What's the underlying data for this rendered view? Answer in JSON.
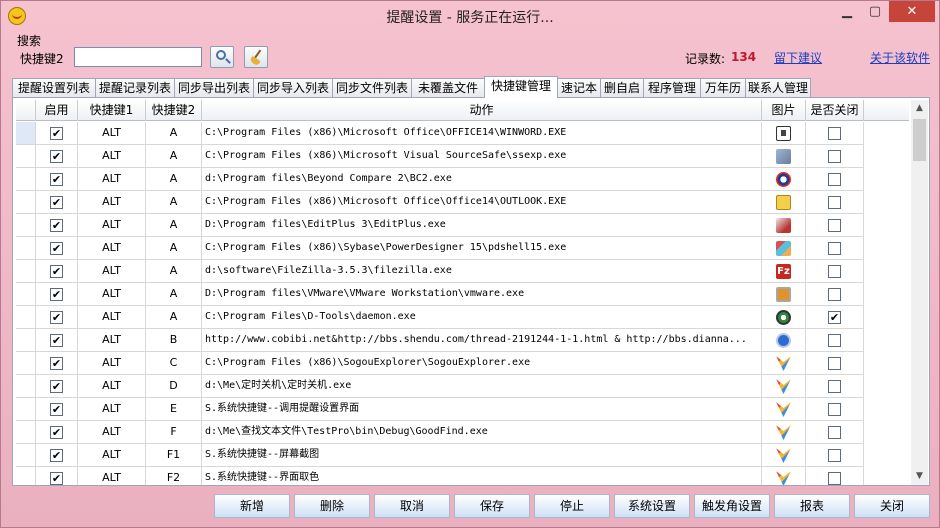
{
  "window": {
    "title": "提醒设置 - 服务正在运行..."
  },
  "search": {
    "group_label": "搜索",
    "hotkey_label": "快捷键2",
    "input_value": "",
    "record_label": "记录数:",
    "record_count": "134",
    "suggest_link": "留下建议",
    "about_link": "关于该软件"
  },
  "tabs": [
    {
      "label": "提醒设置列表"
    },
    {
      "label": "提醒记录列表"
    },
    {
      "label": "同步导出列表"
    },
    {
      "label": "同步导入列表"
    },
    {
      "label": "同步文件列表"
    },
    {
      "label": "未覆盖文件"
    },
    {
      "label": "快捷键管理",
      "active": true
    },
    {
      "label": "速记本"
    },
    {
      "label": "删自启"
    },
    {
      "label": "程序管理"
    },
    {
      "label": "万年历"
    },
    {
      "label": "联系人管理"
    }
  ],
  "table": {
    "columns": [
      "启用",
      "快捷键1",
      "快捷键2",
      "动作",
      "图片",
      "是否关闭"
    ],
    "rows": [
      {
        "enabled": true,
        "k1": "ALT",
        "k2": "A",
        "action": "C:\\Program Files (x86)\\Microsoft Office\\OFFICE14\\WINWORD.EXE",
        "icon": "word-icon",
        "close": false
      },
      {
        "enabled": true,
        "k1": "ALT",
        "k2": "A",
        "action": "C:\\Program Files (x86)\\Microsoft Visual SourceSafe\\ssexp.exe",
        "icon": "sourcesafe-icon",
        "close": false
      },
      {
        "enabled": true,
        "k1": "ALT",
        "k2": "A",
        "action": "d:\\Program files\\Beyond Compare 2\\BC2.exe",
        "icon": "beyond-compare-icon",
        "close": false
      },
      {
        "enabled": true,
        "k1": "ALT",
        "k2": "A",
        "action": "C:\\Program Files (x86)\\Microsoft Office\\Office14\\OUTLOOK.EXE",
        "icon": "outlook-icon",
        "close": false
      },
      {
        "enabled": true,
        "k1": "ALT",
        "k2": "A",
        "action": "D:\\Program files\\EditPlus 3\\EditPlus.exe",
        "icon": "editplus-icon",
        "close": false
      },
      {
        "enabled": true,
        "k1": "ALT",
        "k2": "A",
        "action": "C:\\Program Files (x86)\\Sybase\\PowerDesigner 15\\pdshell15.exe",
        "icon": "powerdesigner-icon",
        "close": false
      },
      {
        "enabled": true,
        "k1": "ALT",
        "k2": "A",
        "action": "d:\\software\\FileZilla-3.5.3\\filezilla.exe",
        "icon": "filezilla-icon",
        "close": false
      },
      {
        "enabled": true,
        "k1": "ALT",
        "k2": "A",
        "action": "D:\\Program files\\VMware\\VMware Workstation\\vmware.exe",
        "icon": "vmware-icon",
        "close": false
      },
      {
        "enabled": true,
        "k1": "ALT",
        "k2": "A",
        "action": "C:\\Program Files\\D-Tools\\daemon.exe",
        "icon": "daemon-tools-icon",
        "close": true
      },
      {
        "enabled": true,
        "k1": "ALT",
        "k2": "B",
        "action": "http://www.cobibi.net&http://bbs.shendu.com/thread-2191244-1-1.html & http://bbs.dianna...",
        "icon": "maxthon-icon",
        "close": false
      },
      {
        "enabled": true,
        "k1": "ALT",
        "k2": "C",
        "action": "C:\\Program Files (x86)\\SogouExplorer\\SogouExplorer.exe",
        "icon": "sogou-icon",
        "close": false
      },
      {
        "enabled": true,
        "k1": "ALT",
        "k2": "D",
        "action": "d:\\Me\\定时关机\\定时关机.exe",
        "icon": "sogou-icon",
        "close": false
      },
      {
        "enabled": true,
        "k1": "ALT",
        "k2": "E",
        "action": "S.系统快捷键--调用提醒设置界面",
        "icon": "sogou-icon",
        "close": false
      },
      {
        "enabled": true,
        "k1": "ALT",
        "k2": "F",
        "action": "d:\\Me\\查找文本文件\\TestPro\\bin\\Debug\\GoodFind.exe",
        "icon": "sogou-icon",
        "close": false
      },
      {
        "enabled": true,
        "k1": "ALT",
        "k2": "F1",
        "action": "S.系统快捷键--屏幕截图",
        "icon": "sogou-icon",
        "close": false
      },
      {
        "enabled": true,
        "k1": "ALT",
        "k2": "F2",
        "action": "S.系统快捷键--界面取色",
        "icon": "sogou-icon",
        "close": false
      }
    ]
  },
  "buttons": [
    {
      "label": "新增"
    },
    {
      "label": "删除"
    },
    {
      "label": "取消"
    },
    {
      "label": "保存"
    },
    {
      "label": "停止"
    },
    {
      "label": "系统设置"
    },
    {
      "label": "触发角设置"
    },
    {
      "label": "报表"
    },
    {
      "label": "关闭"
    }
  ],
  "colors": {
    "window_bg": "#f6c2cf",
    "record_count": "#c0192b",
    "link": "#1b3ebf",
    "close_button": "#c7443b"
  }
}
